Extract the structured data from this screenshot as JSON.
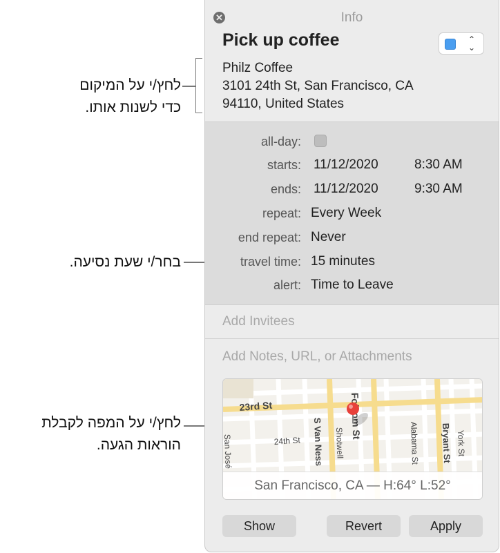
{
  "callouts": {
    "location_line1": "לחץ/י על המיקום",
    "location_line2": "כדי לשנות אותו.",
    "travel": "בחר/י שעת נסיעה.",
    "map_line1": "לחץ/י על המפה לקבלת",
    "map_line2": "הוראות הגעה."
  },
  "window": {
    "title": "Info",
    "close_icon": "close-icon"
  },
  "event": {
    "title": "Pick up coffee",
    "calendar_color": "#4a9ef0",
    "location_name": "Philz Coffee",
    "location_line2": "3101 24th St, San Francisco, CA",
    "location_line3": "94110, United States"
  },
  "details": {
    "allday_label": "all-day:",
    "starts_label": "starts:",
    "starts_date": "11/12/2020",
    "starts_time": "8:30 AM",
    "ends_label": "ends:",
    "ends_date": "11/12/2020",
    "ends_time": "9:30 AM",
    "repeat_label": "repeat:",
    "repeat_value": "Every Week",
    "endrepeat_label": "end repeat:",
    "endrepeat_value": "Never",
    "travel_label": "travel time:",
    "travel_value": "15 minutes",
    "alert_label": "alert:",
    "alert_value": "Time to Leave"
  },
  "fields": {
    "invitees_placeholder": "Add Invitees",
    "notes_placeholder": "Add Notes, URL, or Attachments"
  },
  "map": {
    "streets": [
      "23rd St",
      "24th St",
      "S Van Ness",
      "Shotwell",
      "Folsom St",
      "Alabama St",
      "Bryant St",
      "York St",
      "San José"
    ],
    "weather": "San Francisco, CA — H:64° L:52°"
  },
  "buttons": {
    "show": "Show",
    "revert": "Revert",
    "apply": "Apply"
  }
}
